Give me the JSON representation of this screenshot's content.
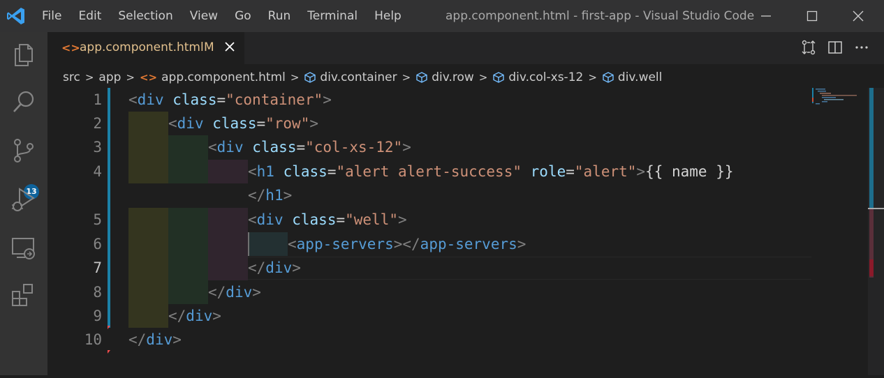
{
  "titlebar": {
    "menu": [
      "File",
      "Edit",
      "Selection",
      "View",
      "Go",
      "Run",
      "Terminal",
      "Help"
    ],
    "window_title": "app.component.html - first-app - Visual Studio Code"
  },
  "activity": {
    "icons": [
      "explorer-icon",
      "search-icon",
      "source-control-icon",
      "run-debug-icon",
      "remote-explorer-icon",
      "extensions-icon"
    ],
    "source_control_badge": "13"
  },
  "tab": {
    "label": "app.component.html",
    "modified": "M"
  },
  "breadcrumb": {
    "items": [
      "src",
      "app",
      "app.component.html",
      "div.container",
      "div.row",
      "div.col-xs-12",
      "div.well"
    ]
  },
  "editor": {
    "line_numbers": [
      "1",
      "2",
      "3",
      "4",
      "",
      "5",
      "6",
      "7",
      "8",
      "9",
      "10"
    ],
    "active_line": "7",
    "lines": [
      [
        [
          "br",
          "<"
        ],
        [
          "tag",
          "div"
        ],
        [
          "txt",
          " "
        ],
        [
          "attr",
          "class"
        ],
        [
          "txt",
          "="
        ],
        [
          "str",
          "\"container\""
        ],
        [
          "br",
          ">"
        ]
      ],
      [
        [
          "br",
          "<"
        ],
        [
          "tag",
          "div"
        ],
        [
          "txt",
          " "
        ],
        [
          "attr",
          "class"
        ],
        [
          "txt",
          "="
        ],
        [
          "str",
          "\"row\""
        ],
        [
          "br",
          ">"
        ]
      ],
      [
        [
          "br",
          "<"
        ],
        [
          "tag",
          "div"
        ],
        [
          "txt",
          " "
        ],
        [
          "attr",
          "class"
        ],
        [
          "txt",
          "="
        ],
        [
          "str",
          "\"col-xs-12\""
        ],
        [
          "br",
          ">"
        ]
      ],
      [
        [
          "br",
          "<"
        ],
        [
          "tag",
          "h1"
        ],
        [
          "txt",
          " "
        ],
        [
          "attr",
          "class"
        ],
        [
          "txt",
          "="
        ],
        [
          "str",
          "\"alert alert-success\""
        ],
        [
          "txt",
          " "
        ],
        [
          "attr",
          "role"
        ],
        [
          "txt",
          "="
        ],
        [
          "str",
          "\"alert\""
        ],
        [
          "br",
          ">"
        ],
        [
          "txt",
          "{{ name }}"
        ]
      ],
      [
        [
          "br",
          "</"
        ],
        [
          "tag",
          "h1"
        ],
        [
          "br",
          ">"
        ]
      ],
      [
        [
          "br",
          "<"
        ],
        [
          "tag",
          "div"
        ],
        [
          "txt",
          " "
        ],
        [
          "attr",
          "class"
        ],
        [
          "txt",
          "="
        ],
        [
          "str",
          "\"well\""
        ],
        [
          "br",
          ">"
        ]
      ],
      [
        [
          "br",
          "<"
        ],
        [
          "tag",
          "app-servers"
        ],
        [
          "br",
          "></"
        ],
        [
          "tag",
          "app-servers"
        ],
        [
          "br",
          ">"
        ]
      ],
      [
        [
          "br",
          "</"
        ],
        [
          "tag",
          "div"
        ],
        [
          "br",
          ">"
        ]
      ],
      [
        [
          "br",
          "</"
        ],
        [
          "tag",
          "div"
        ],
        [
          "br",
          ">"
        ]
      ],
      [
        [
          "br",
          "</"
        ],
        [
          "tag",
          "div"
        ],
        [
          "br",
          ">"
        ]
      ],
      [
        [
          "br",
          "</"
        ],
        [
          "tag",
          "div"
        ],
        [
          "br",
          ">"
        ]
      ]
    ]
  },
  "colors": {
    "tag": "#569cd6",
    "attr": "#9cdcfe",
    "string": "#ce9178",
    "modified": "#e2c08d",
    "badge": "#0e639c"
  }
}
